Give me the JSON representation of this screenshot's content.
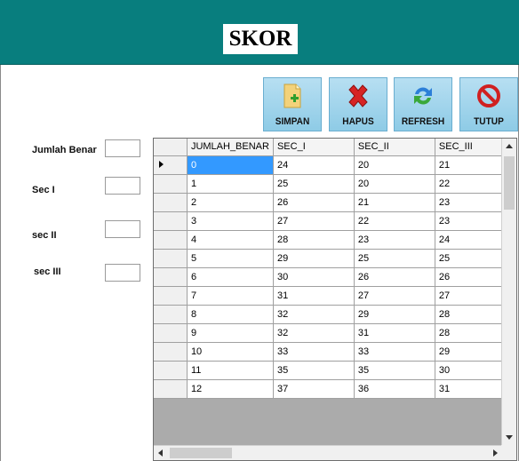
{
  "window": {
    "title": "SKOR"
  },
  "toolbar": {
    "simpan_label": "SIMPAN",
    "hapus_label": "HAPUS",
    "refresh_label": "REFRESH",
    "tutup_label": "TUTUP",
    "icons": {
      "simpan": "new-document-icon",
      "hapus": "red-x-icon",
      "refresh": "refresh-arrows-icon",
      "tutup": "no-entry-icon"
    }
  },
  "form": {
    "jumlah_benar_label": "Jumlah Benar",
    "jumlah_benar_value": "",
    "sec1_label": "Sec I",
    "sec1_value": "",
    "sec2_label": "sec II",
    "sec2_value": "",
    "sec3_label": "sec III",
    "sec3_value": ""
  },
  "grid": {
    "columns": [
      "JUMLAH_BENAR",
      "SEC_I",
      "SEC_II",
      "SEC_III"
    ],
    "selected_row": 0,
    "rows": [
      [
        "0",
        "24",
        "20",
        "21"
      ],
      [
        "1",
        "25",
        "20",
        "22"
      ],
      [
        "2",
        "26",
        "21",
        "23"
      ],
      [
        "3",
        "27",
        "22",
        "23"
      ],
      [
        "4",
        "28",
        "23",
        "24"
      ],
      [
        "5",
        "29",
        "25",
        "25"
      ],
      [
        "6",
        "30",
        "26",
        "26"
      ],
      [
        "7",
        "31",
        "27",
        "27"
      ],
      [
        "8",
        "32",
        "29",
        "28"
      ],
      [
        "9",
        "32",
        "31",
        "28"
      ],
      [
        "10",
        "33",
        "33",
        "29"
      ],
      [
        "11",
        "35",
        "35",
        "30"
      ],
      [
        "12",
        "37",
        "36",
        "31"
      ]
    ]
  },
  "colors": {
    "header_bg": "#087e7e",
    "button_bg": "#9fd4ec",
    "selection": "#3399ff"
  }
}
